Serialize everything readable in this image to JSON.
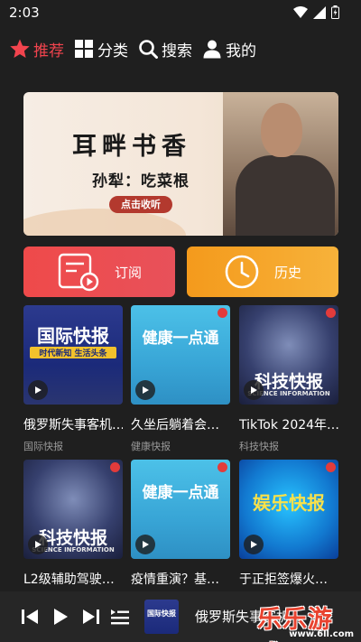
{
  "status_bar": {
    "time": "2:03"
  },
  "nav": {
    "items": [
      {
        "label": "推荐",
        "icon": "star-icon",
        "active": true
      },
      {
        "label": "分类",
        "icon": "grid-icon",
        "active": false
      },
      {
        "label": "搜索",
        "icon": "search-icon",
        "active": false
      },
      {
        "label": "我的",
        "icon": "user-icon",
        "active": false
      }
    ]
  },
  "banner": {
    "title": "耳畔书香",
    "subtitle": "孙犁：吃菜根",
    "button": "点击收听"
  },
  "actions": {
    "subscribe": "订阅",
    "history": "历史"
  },
  "cards": [
    {
      "title": "俄罗斯失事客机…",
      "category": "国际快报",
      "thumb_text": "国际快报",
      "thumb_sub": "时代新知  生活头条",
      "style": "intl"
    },
    {
      "title": "久坐后躺着会…",
      "category": "健康快报",
      "thumb_text": "健康一点通",
      "style": "health"
    },
    {
      "title": "TikTok 2024年…",
      "category": "科技快报",
      "thumb_text": "科技快报",
      "thumb_sub": "SCIENCE INFORMATION",
      "style": "tech"
    },
    {
      "title": "L2级辅助驾驶…",
      "category": "",
      "thumb_text": "科技快报",
      "thumb_sub": "SCIENCE INFORMATION",
      "style": "tech"
    },
    {
      "title": "疫情重演？基…",
      "category": "",
      "thumb_text": "健康一点通",
      "style": "health"
    },
    {
      "title": "于正拒签爆火…",
      "category": "",
      "thumb_text": "娱乐快报",
      "style": "ent"
    }
  ],
  "player": {
    "title": "俄罗斯失事客机",
    "thumb_text": "国际快报"
  },
  "watermark": {
    "main": "乐乐游戏",
    "sub": "www.6ll.com"
  },
  "colors": {
    "accent": "#f2444e",
    "subscribe": "#ef4a4a",
    "history": "#f49a1c",
    "background": "#1f1f1f"
  }
}
